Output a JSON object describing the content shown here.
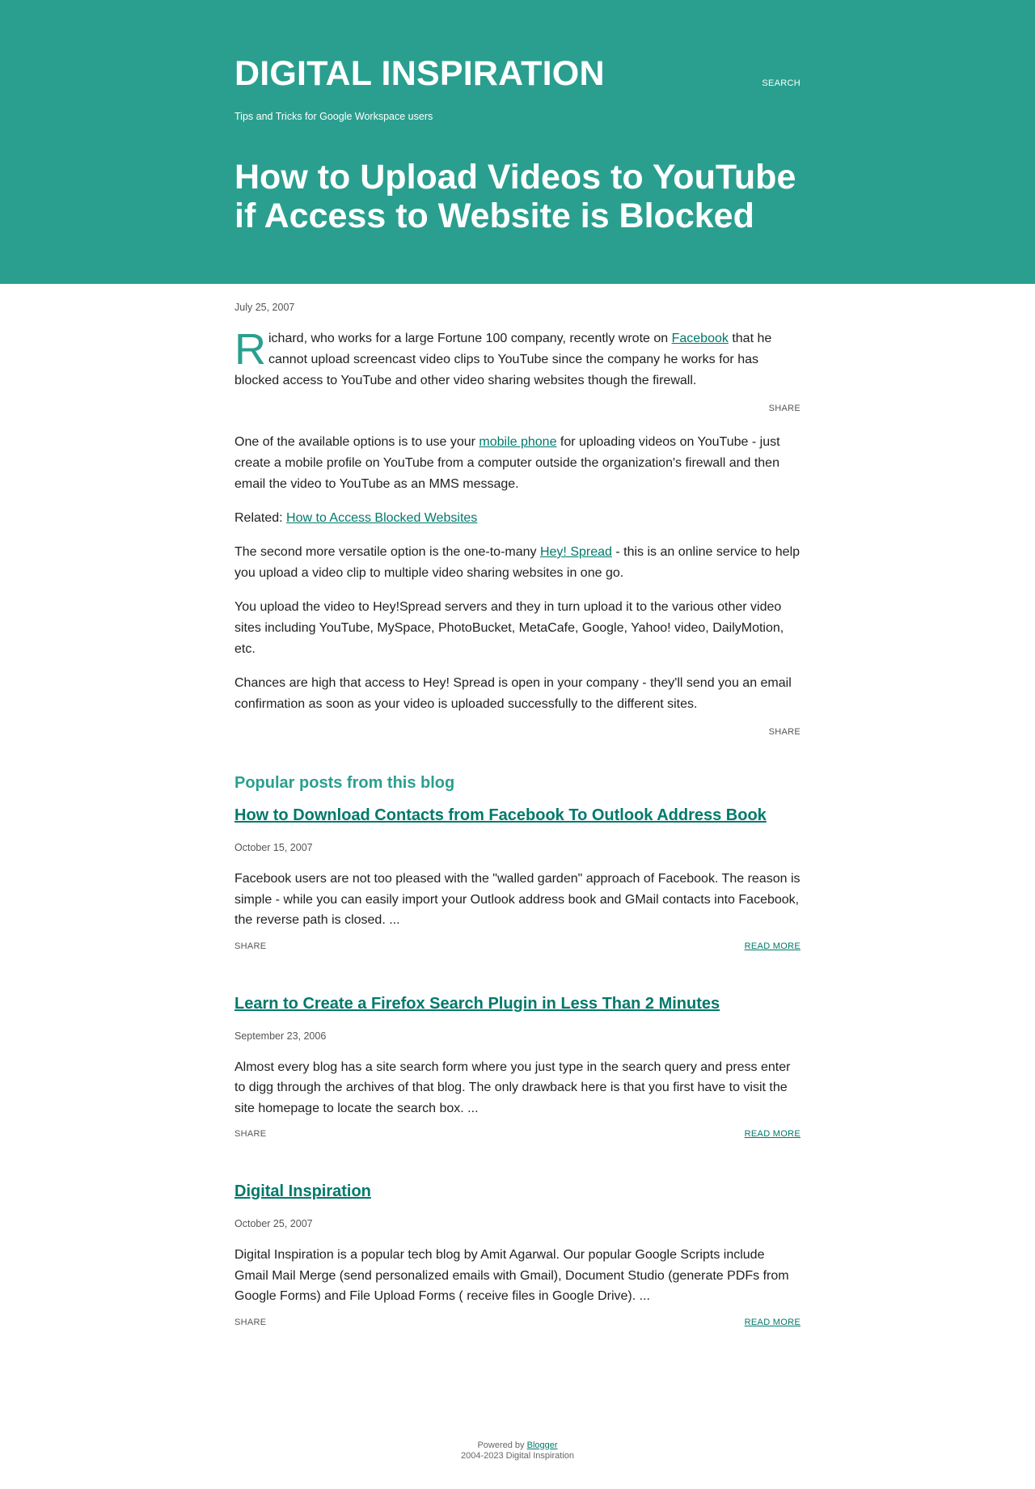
{
  "header": {
    "site_title": "DIGITAL INSPIRATION",
    "search_label": "SEARCH",
    "tagline": "Tips and Tricks for Google Workspace users",
    "post_title": "How to Upload Videos to YouTube if Access to Website is Blocked",
    "background_color": "#2a9f8f"
  },
  "post": {
    "date": "July 25, 2007",
    "intro": {
      "dropcap": "R",
      "text_before_link": "ichard, who works for a large Fortune 100 company, recently wrote on ",
      "link_text": "Facebook",
      "text_after_link": " that he cannot upload screencast video clips to YouTube since the company he works for has blocked access to YouTube and other video sharing websites though the firewall."
    },
    "share_label": "SHARE",
    "para2": {
      "before": "One of the available options is to use your ",
      "link": "mobile phone",
      "after": " for uploading videos on YouTube - just create a mobile profile on YouTube from a computer outside the organization's firewall and then email the video to YouTube as an MMS message."
    },
    "related": {
      "label": "Related: ",
      "link": "How to Access Blocked Websites"
    },
    "para3": {
      "before": "The second more versatile option is the one-to-many ",
      "link": "Hey! Spread",
      "after": " - this is an online service to help you upload a video clip to multiple video sharing websites in one go."
    },
    "para4": "You upload the video to Hey!Spread servers and they in turn upload it to the various other video sites including YouTube, MySpace, PhotoBucket, MetaCafe, Google, Yahoo! video, DailyMotion, etc.",
    "para5": "Chances are high that access to Hey! Spread is open in your company - they'll send you an email confirmation as soon as your video is uploaded successfully to the different sites."
  },
  "popular": {
    "heading": "Popular posts from this blog",
    "share_label": "SHARE",
    "read_more_label": "READ MORE",
    "items": [
      {
        "title": "How to Download Contacts from Facebook To Outlook Address Book",
        "date": "October 15, 2007",
        "snippet": "Facebook users are not too pleased with the \"walled garden\" approach of Facebook. The reason is simple - while you can easily import your Outlook address book and GMail contacts into Facebook, the reverse path is closed. ..."
      },
      {
        "title": "Learn to Create a Firefox Search Plugin in Less Than 2 Minutes",
        "date": "September 23, 2006",
        "snippet": "Almost every blog has a site search form where you just type in the search query and press enter to digg through the archives of that blog. The only drawback here is that you first have to visit the site homepage to locate the search box. ..."
      },
      {
        "title": "Digital Inspiration",
        "date": "October 25, 2007",
        "snippet": "Digital Inspiration is a popular tech blog by Amit Agarwal. Our popular Google Scripts include Gmail Mail Merge (send personalized emails with Gmail), Document Studio (generate PDFs from Google Forms) and File Upload Forms ( receive files in Google Drive). ..."
      }
    ]
  },
  "footer": {
    "powered_by": "Powered by ",
    "blogger_link": "Blogger",
    "copyright": "2004-2023 Digital Inspiration"
  }
}
